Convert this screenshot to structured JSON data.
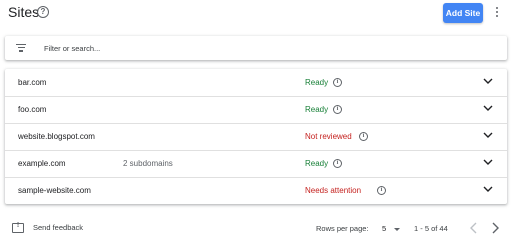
{
  "header": {
    "title": "Sites",
    "add_label": "Add Site",
    "help_icon": "help-circle-icon",
    "more_icon": "more-vert-icon"
  },
  "filter": {
    "placeholder": "Filter or search...",
    "value": "",
    "icon": "filter-list-icon"
  },
  "sites": [
    {
      "name": "bar.com",
      "subdomains": "",
      "status": "Ready",
      "status_kind": "ok"
    },
    {
      "name": "foo.com",
      "subdomains": "",
      "status": "Ready",
      "status_kind": "ok"
    },
    {
      "name": "website.blogspot.com",
      "subdomains": "",
      "status": "Not reviewed",
      "status_kind": "bad"
    },
    {
      "name": "example.com",
      "subdomains": "2 subdomains",
      "status": "Ready",
      "status_kind": "ok"
    },
    {
      "name": "sample-website.com",
      "subdomains": "",
      "status": "Needs attention",
      "status_kind": "bad"
    }
  ],
  "footer": {
    "feedback_label": "Send feedback",
    "rows_per_page_label": "Rows per page:",
    "rows_per_page_value": "5",
    "range_label": "1 - 5 of 44"
  },
  "colors": {
    "accent": "#4285f4",
    "ready": "#188038",
    "attention": "#c5221f"
  }
}
